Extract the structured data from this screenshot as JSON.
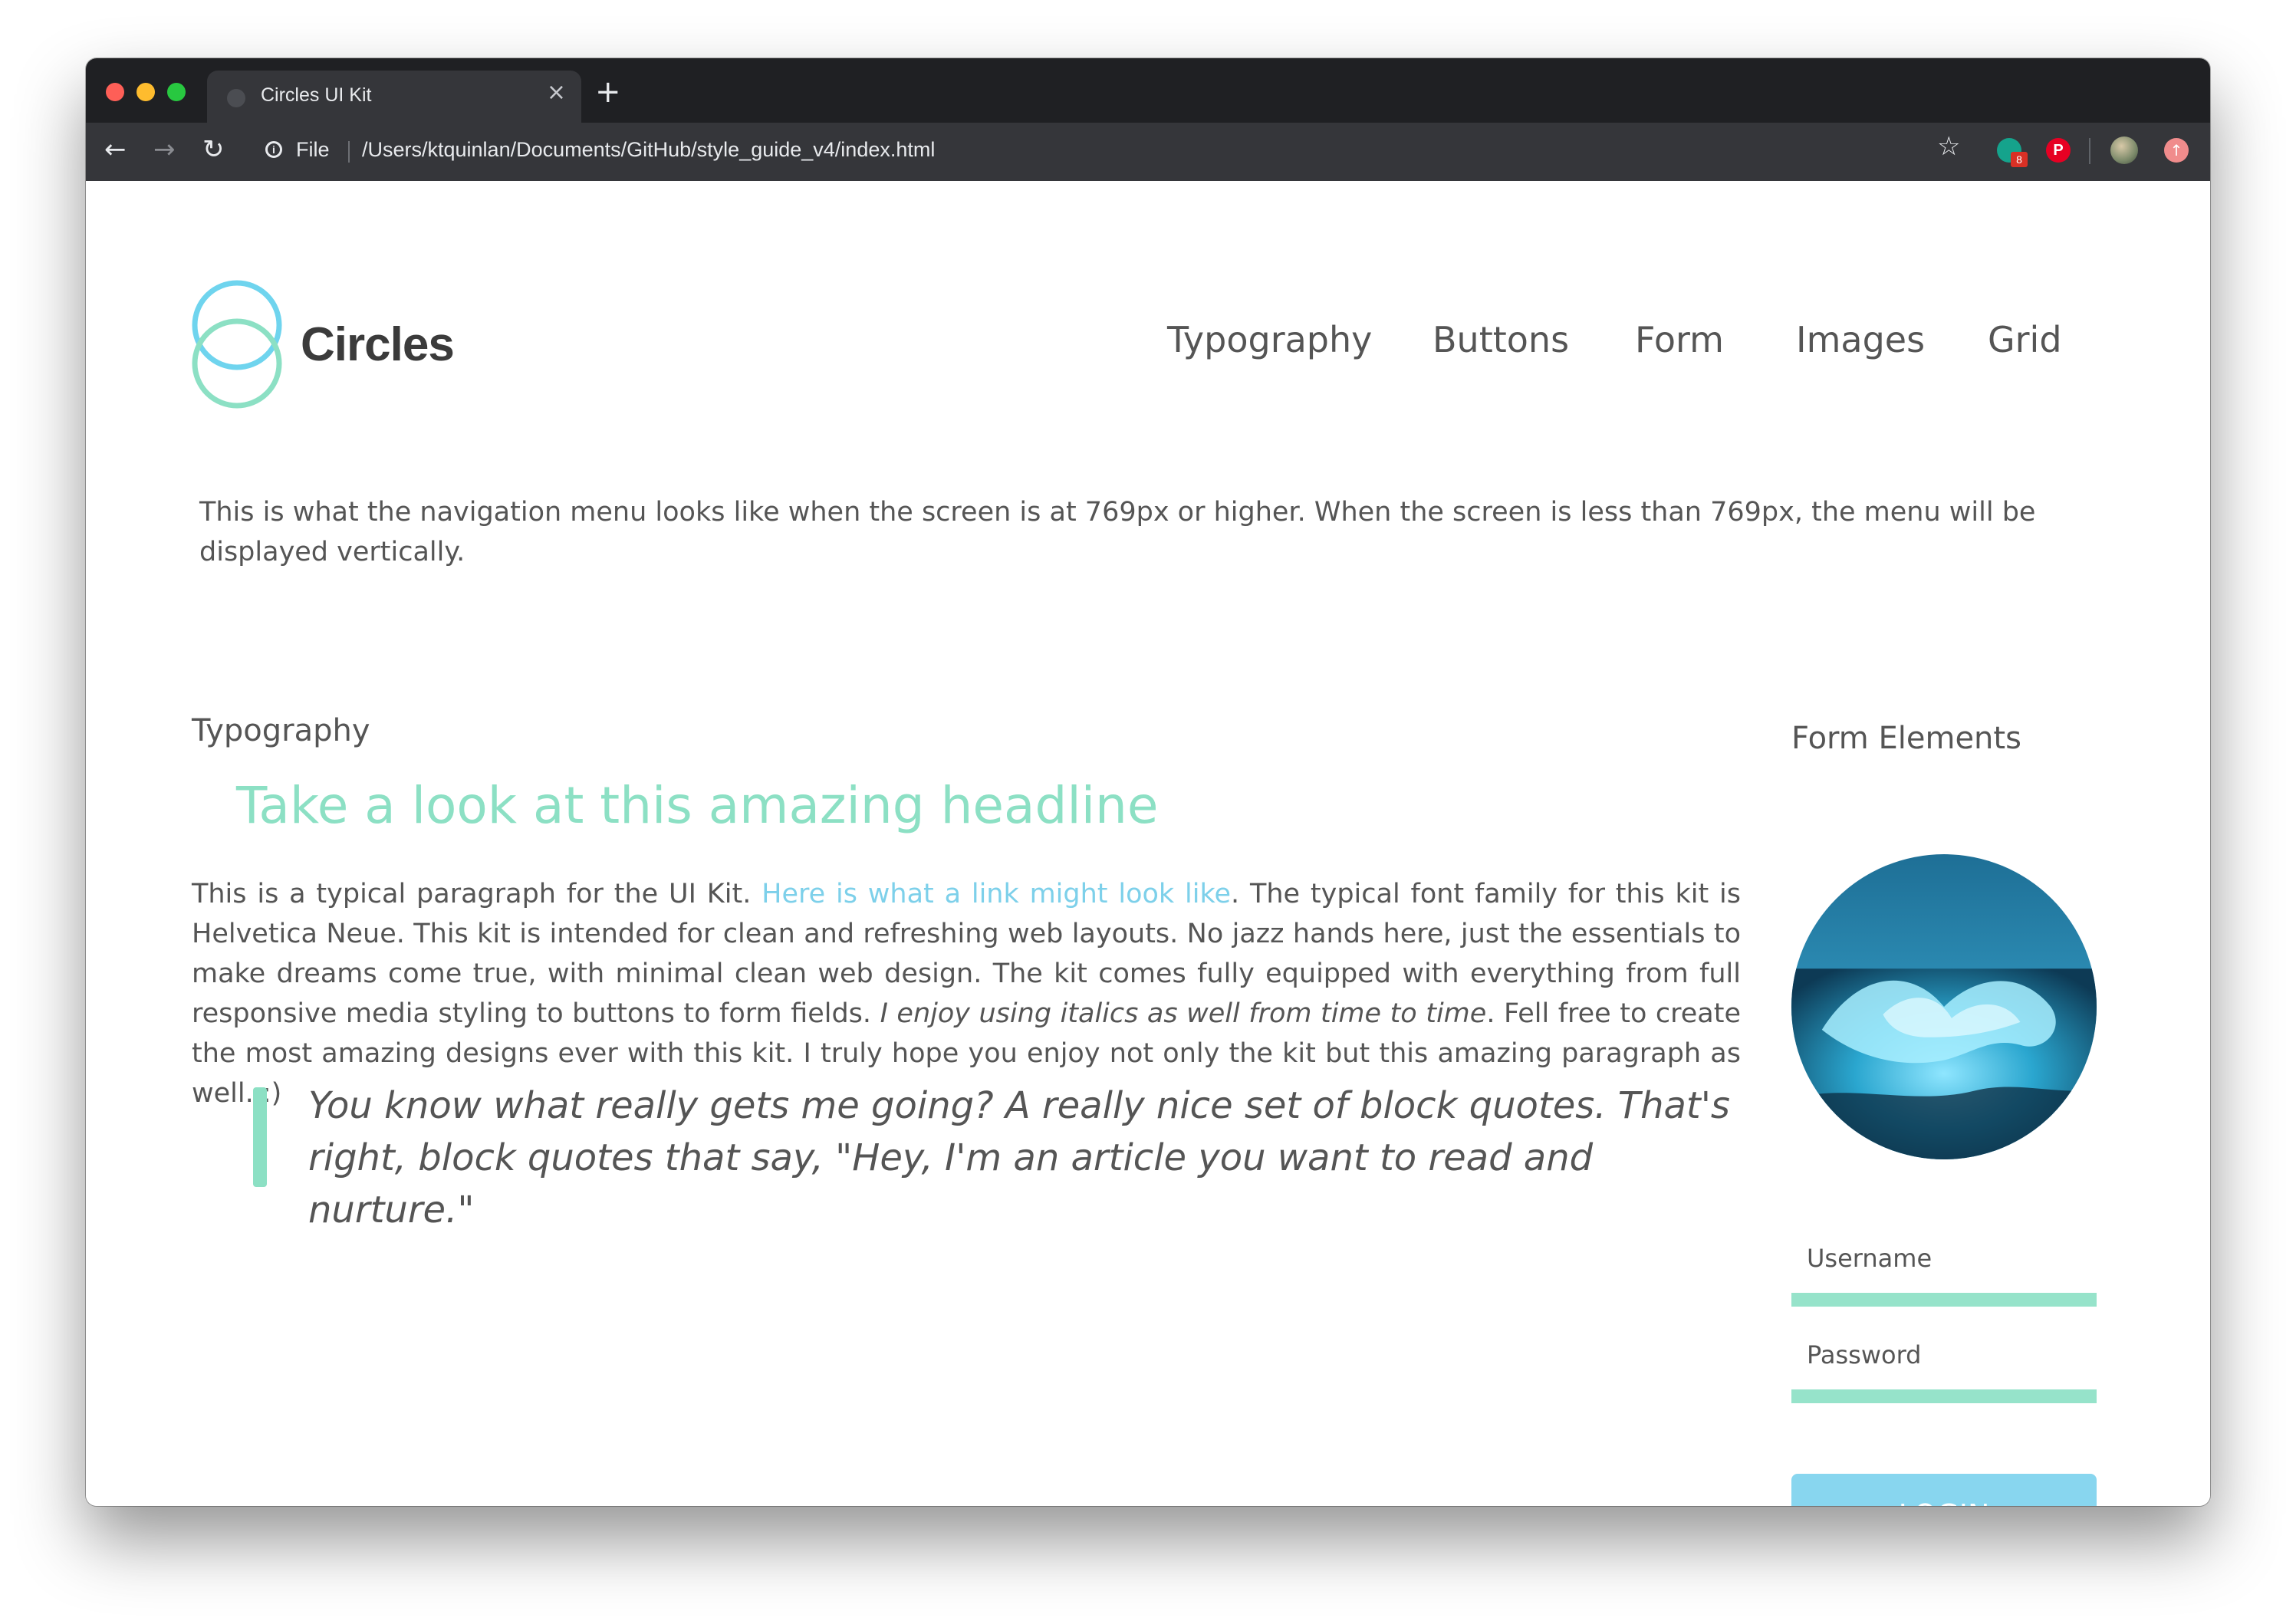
{
  "browser": {
    "tab_title": "Circles UI Kit",
    "tab_close_icon": "×",
    "new_tab_icon": "+",
    "back_icon": "←",
    "forward_icon": "→",
    "reload_icon": "↻",
    "info_icon": "i",
    "url_scheme": "File",
    "url": "/Users/ktquinlan/Documents/GitHub/style_guide_v4/index.html",
    "bookmark_icon": "☆",
    "extensions": {
      "grammarly_badge": "8",
      "pinterest_glyph": "P",
      "upload_glyph": "↑"
    }
  },
  "header": {
    "brand": "Circles",
    "logo_colors": [
      "#6fd4ee",
      "#8ce0c4"
    ],
    "nav": [
      "Typography",
      "Buttons",
      "Form",
      "Images",
      "Grid"
    ]
  },
  "intro_text": "This is what the navigation menu looks like when the screen is at 769px or higher. When the screen is less than 769px, the menu will be displayed vertically.",
  "typography": {
    "section_title": "Typography",
    "headline": "Take a look at this amazing headline",
    "paragraph_before_link": "This is a typical paragraph for the UI Kit. ",
    "link_text": "Here is what a link might look like",
    "paragraph_after_link": ". The typical font family for this kit is Helvetica Neue. This kit is intended for clean and refreshing web layouts. No jazz hands here, just the essentials to make dreams come true, with minimal clean web design. The kit comes fully equipped with everything from full responsive media styling to buttons to form fields. ",
    "italic_text": "I enjoy using italics as well from time to time",
    "paragraph_end": ". Fell free to create the most amazing designs ever with this kit. I truly hope you enjoy not only the kit but this amazing paragraph as well. :)",
    "blockquote": "You know what really gets me going? A really nice set of block quotes. That's right, block quotes that say, \"Hey, I'm an article you want to read and nurture.\""
  },
  "form": {
    "section_title": "Form Elements",
    "username_label": "Username",
    "password_label": "Password",
    "login_label": "LOGIN"
  },
  "colors": {
    "accent_green": "#8ce0c4",
    "accent_blue": "#88d6ef",
    "link": "#7dd0ea",
    "text": "#555555"
  }
}
